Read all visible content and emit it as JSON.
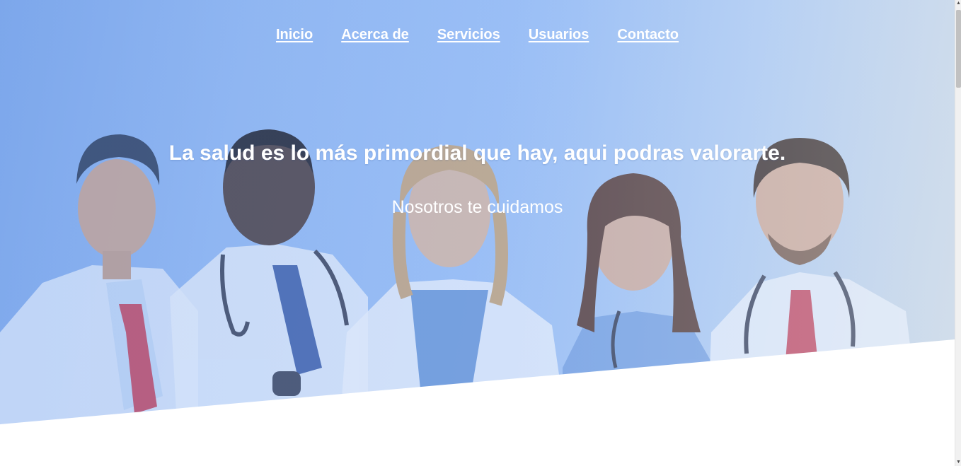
{
  "nav": {
    "items": [
      {
        "label": "Inicio"
      },
      {
        "label": "Acerca de"
      },
      {
        "label": "Servicios"
      },
      {
        "label": "Usuarios"
      },
      {
        "label": "Contacto"
      }
    ]
  },
  "hero": {
    "headline": "La salud es lo más primordial que hay, aqui podras valorarte.",
    "subheadline": "Nosotros te cuidamos"
  },
  "colors": {
    "hero_overlay": "#9cc0f6",
    "text": "#ffffff",
    "background": "#ffffff"
  },
  "icons": {
    "scroll_up": "triangle-up-icon",
    "scroll_down": "triangle-down-icon"
  }
}
